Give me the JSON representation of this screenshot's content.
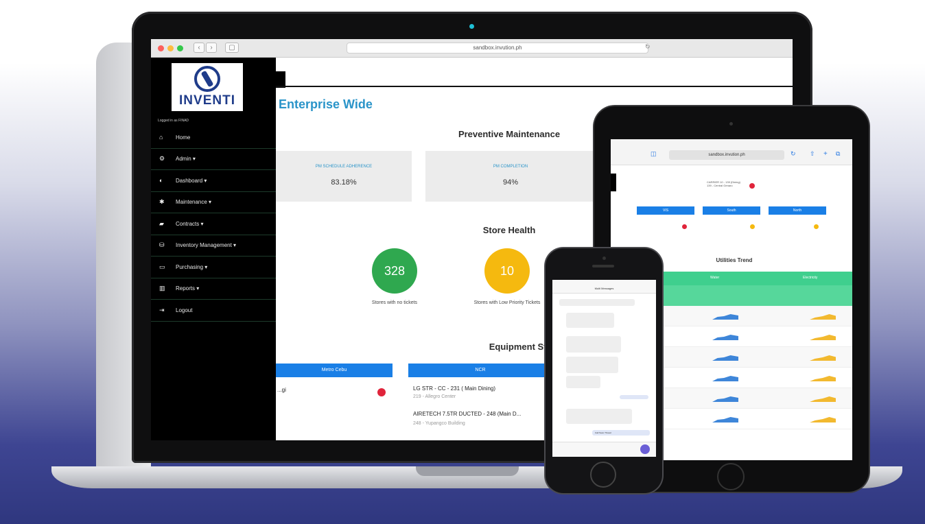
{
  "laptop": {
    "url": "sandbox.invution.ph",
    "logo_text": "INVENTI",
    "logged_in": "Logged in as FINAD",
    "menu": [
      {
        "label": "Home",
        "icon": "home-icon",
        "glyph": "⌂"
      },
      {
        "label": "Admin ▾",
        "icon": "gears-icon",
        "glyph": "⚙"
      },
      {
        "label": "Dashboard ▾",
        "icon": "dashboard-icon",
        "glyph": "◐"
      },
      {
        "label": "Maintenance ▾",
        "icon": "wrench-icon",
        "glyph": "✱"
      },
      {
        "label": "Contracts ▾",
        "icon": "book-icon",
        "glyph": "▰"
      },
      {
        "label": "Inventory Management ▾",
        "icon": "inventory-icon",
        "glyph": "⛁"
      },
      {
        "label": "Purchasing ▾",
        "icon": "card-icon",
        "glyph": "▭"
      },
      {
        "label": "Reports ▾",
        "icon": "chart-icon",
        "glyph": "▥"
      },
      {
        "label": "Logout",
        "icon": "logout-icon",
        "glyph": "⇥"
      }
    ],
    "page_title": "Enterprise Wide",
    "pm_title": "Preventive Maintenance",
    "kpi": [
      {
        "label": "PM SCHEDULE ADHERENCE",
        "value": "83.18%"
      },
      {
        "label": "PM COMPLETION",
        "value": "94%"
      }
    ],
    "store_health_title": "Store Health",
    "store_health": [
      {
        "value": "328",
        "caption": "Stores with no tickets",
        "color": "#2fa84f"
      },
      {
        "value": "10",
        "caption": "Stores with Low Priority Tickets",
        "color": "#f5b90f"
      }
    ],
    "equipment_title": "Equipment Status",
    "equipment_columns": [
      {
        "header": "Metro Cebu",
        "item": "...gi",
        "status_color": "#e0243b"
      },
      {
        "header": "NCR",
        "item1": "LG STR - CC - 231 ( Main Dining)",
        "sub1": "219 - Allegro Center",
        "item2": "AIRETECH 7.5TR DUCTED - 248 (Main D...",
        "sub2": "248 - Yupangco Building"
      }
    ]
  },
  "tablet": {
    "url": "sandbox.invution.ph",
    "regions": [
      "VIS",
      "South",
      "North"
    ],
    "utilities_title": "Utilities Trend",
    "table_groups": [
      "Water",
      "Electricity"
    ],
    "rows": 6
  },
  "phone": {
    "header": "Multi Messages",
    "send_label": "Call Team Thread"
  }
}
